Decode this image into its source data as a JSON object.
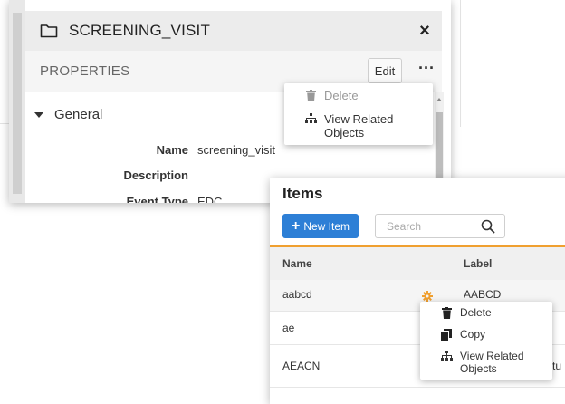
{
  "properties_panel": {
    "title": "SCREENING_VISIT",
    "close_symbol": "×",
    "bar_label": "PROPERTIES",
    "edit_label": "Edit",
    "more_symbol": "···",
    "section": "General",
    "fields": [
      {
        "label": "Name",
        "value": "screening_visit"
      },
      {
        "label": "Description",
        "value": ""
      },
      {
        "label": "Event Type",
        "value": "EDC"
      }
    ],
    "menu": [
      {
        "label": "Delete",
        "icon": "trash-icon",
        "disabled": true
      },
      {
        "label": "View Related Objects",
        "icon": "sitemap-icon",
        "disabled": false
      }
    ]
  },
  "items_panel": {
    "title": "Items",
    "new_item_label": "New Item",
    "search_placeholder": "Search",
    "columns": [
      "Name",
      "Label"
    ],
    "rows": [
      {
        "name": "aabcd",
        "label": "AABCD",
        "highlighted": true
      },
      {
        "name": "ae",
        "label": "",
        "highlighted": false
      },
      {
        "name": "AEACN",
        "label": "tu",
        "highlighted": false
      }
    ],
    "context_menu": [
      {
        "label": "Delete",
        "icon": "trash-icon"
      },
      {
        "label": "Copy",
        "icon": "copy-icon"
      },
      {
        "label": "View Related Objects",
        "icon": "sitemap-icon"
      }
    ]
  },
  "colors": {
    "primary_button": "#2d7fd6",
    "accent_line": "#f0a030",
    "gear": "#f0a030"
  }
}
